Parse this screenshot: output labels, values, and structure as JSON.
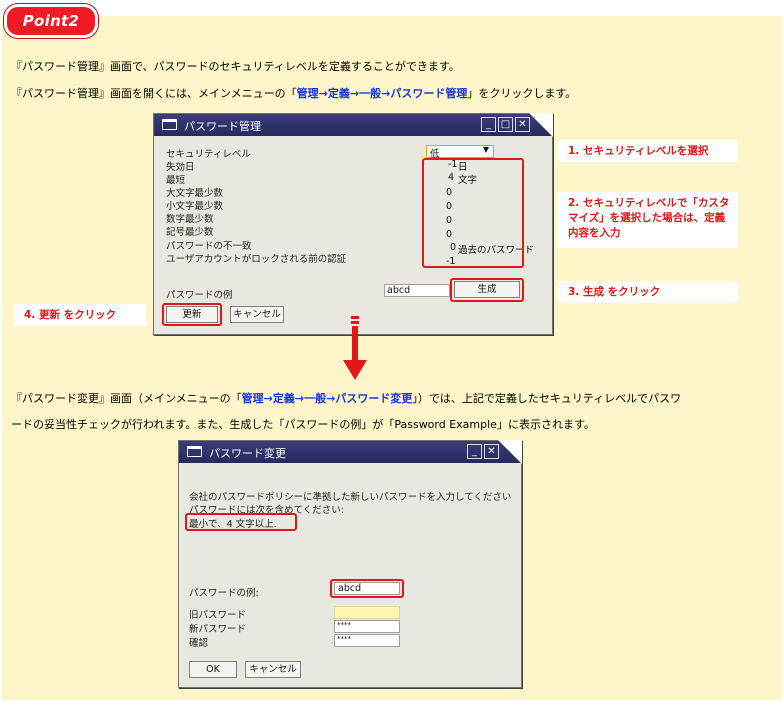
{
  "point_badge": "Point2",
  "intro": {
    "line1": "『パスワード管理』画面で、パスワードのセキュリティレベルを定義することができます。",
    "line2_pre": "『パスワード管理』画面を開くには、メインメニューの「",
    "line2_hl": "管理→定義→一般→パスワード管理",
    "line2_post": "」をクリックします。"
  },
  "mgmt_window": {
    "title": "パスワード管理",
    "security_level_label": "セキュリティレベル",
    "security_level_value": "低",
    "rows": [
      {
        "label": "失効日",
        "value": "-1",
        "unit": "日"
      },
      {
        "label": "最短",
        "value": "4",
        "unit": "文字"
      },
      {
        "label": "大文字最少数",
        "value": "0",
        "unit": ""
      },
      {
        "label": "小文字最少数",
        "value": "0",
        "unit": ""
      },
      {
        "label": "数字最少数",
        "value": "0",
        "unit": ""
      },
      {
        "label": "記号最少数",
        "value": "0",
        "unit": ""
      },
      {
        "label": "パスワードの不一致",
        "value": "0",
        "unit": "過去のパスワード"
      },
      {
        "label": "ユーザアカウントがロックされる前の認証",
        "value": "-1",
        "unit": ""
      }
    ],
    "example_label": "パスワードの例",
    "example_value": "abcd",
    "generate_button": "生成",
    "update_button": "更新",
    "cancel_button": "キャンセル"
  },
  "notes": {
    "n1": "1. セキュリティレベルを選択",
    "n2": "2. セキュリティレベルで「カスタマイズ」を選択した場合は、定義内容を入力",
    "n3": "3. 生成 をクリック",
    "n4": "4. 更新 をクリック"
  },
  "change_para": {
    "line1_pre": "『パスワード変更』画面（メインメニューの「",
    "line1_hl": "管理→定義→一般→パスワード変更",
    "line1_post": "」）では、上記で定義したセキュリティレベルでパスワ",
    "line2": "ードの妥当性チェックが行われます。また、生成した「パスワードの例」が「Password Example」に表示されます。"
  },
  "change_window": {
    "title": "パスワード変更",
    "msg1": "会社のパスワードポリシーに準拠した新しいパスワードを入力してください",
    "msg2": "パスワードには次を含めてください:",
    "msg3": "最小で、4 文字以上.",
    "example_label": "パスワードの例:",
    "example_value": "abcd",
    "old_pw_label": "旧パスワード",
    "new_pw_label": "新パスワード",
    "new_pw_value": "****",
    "confirm_label": "確認",
    "confirm_value": "****",
    "ok_button": "OK",
    "cancel_button": "キャンセル"
  },
  "colors": {
    "panel": "#fef6c8",
    "accent_red": "#e01818",
    "highlight_blue": "#1a34e0",
    "titlebar": "#2e3168"
  }
}
